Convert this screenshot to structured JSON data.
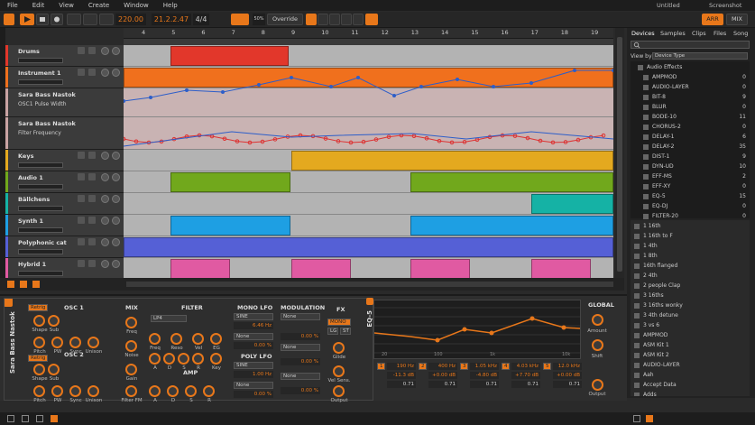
{
  "menu": {
    "items": [
      "File",
      "Edit",
      "View",
      "Create",
      "Window",
      "Help"
    ],
    "doc_title": "Untitled",
    "screenshot_title": "Screenshot"
  },
  "transport": {
    "tempo": "220.00",
    "position": "21.2.2.47",
    "signature": "4/4",
    "override_label": "Override",
    "zoom": "50%"
  },
  "modes": {
    "arr": "ARR",
    "mix": "MIX"
  },
  "ruler": [
    "4",
    "5",
    "6",
    "7",
    "8",
    "9",
    "10",
    "11",
    "12",
    "13",
    "14",
    "15",
    "16",
    "17",
    "18",
    "19"
  ],
  "tracks": [
    {
      "name": "Drums",
      "color": "#e2372b"
    },
    {
      "name": "Instrument 1",
      "color": "#f0701d"
    },
    {
      "name": "Sara Bass Nastok",
      "sub": "OSC1 Pulse Width",
      "color": "#c9a3a3"
    },
    {
      "name": "Sara Bass Nastok",
      "sub": "Filter Frequency",
      "color": "#c9a3a3"
    },
    {
      "name": "Keys",
      "color": "#e4a91f"
    },
    {
      "name": "Audio 1",
      "color": "#71a81c"
    },
    {
      "name": "Bällchens",
      "color": "#15b2a5"
    },
    {
      "name": "Synth 1",
      "color": "#1e9fe3"
    },
    {
      "name": "Polyphonic cat",
      "color": "#5560d6"
    },
    {
      "name": "Hybrid 1",
      "color": "#e05aa2"
    }
  ],
  "browser": {
    "tabs": [
      "Devices",
      "Samples",
      "Clips",
      "Files",
      "Song"
    ],
    "view_by_label": "View by",
    "view_by_value": "Device Type",
    "folder": "Audio Effects",
    "items": [
      {
        "name": "AMPMOD",
        "count": "0"
      },
      {
        "name": "AUDIO-LAYER",
        "count": "0"
      },
      {
        "name": "BIT-8",
        "count": "9"
      },
      {
        "name": "BLUR",
        "count": "0"
      },
      {
        "name": "BODE-10",
        "count": "11"
      },
      {
        "name": "CHORUS-2",
        "count": "0"
      },
      {
        "name": "DELAY-1",
        "count": "6"
      },
      {
        "name": "DELAY-2",
        "count": "35"
      },
      {
        "name": "DIST-1",
        "count": "9"
      },
      {
        "name": "DYN-UD",
        "count": "10"
      },
      {
        "name": "EFF-MS",
        "count": "2"
      },
      {
        "name": "EFF-XY",
        "count": "0"
      },
      {
        "name": "EQ-5",
        "count": "15"
      },
      {
        "name": "EQ-DJ",
        "count": "0"
      },
      {
        "name": "FILTER-20",
        "count": "0"
      }
    ],
    "presets": [
      "1 16th",
      "1 16th to F",
      "1 4th",
      "1 8th",
      "16th flanged",
      "2 4th",
      "2 people Clap",
      "3 16ths",
      "3 16ths wonky",
      "3 4th detune",
      "3 vs 6",
      "AMPMOD",
      "ASM Kit 1",
      "ASM Kit 2",
      "AUDIO-LAYER",
      "Aah",
      "Accept Data",
      "Adds"
    ]
  },
  "device": {
    "name": "Sara Bass Nastok",
    "sections": {
      "osc1": "OSC 1",
      "osc2": "OSC 2",
      "mix": "MIX",
      "filter": "FILTER",
      "amp": "AMP",
      "mono_lfo": "MONO LFO",
      "poly_lfo": "POLY LFO",
      "modulation": "MODULATION",
      "fx": "FX"
    },
    "retrig": "Retrig",
    "filter_type": "LP4",
    "lfo1_shape": "SINE",
    "lfo1_rate": "6.46 Hz",
    "lfo2_shape": "SINE",
    "lfo2_rate": "1.00 Hz",
    "none": "None",
    "percent0": "0.00 %",
    "mono": "MONO",
    "lg": "LG",
    "st": "ST",
    "knob_labels": {
      "pitch": "Pitch",
      "pw": "PW",
      "sync": "Sync",
      "unison": "Unison",
      "shape": "Shape",
      "sub": "Sub",
      "noise": "Noise",
      "gain": "Gain",
      "freq": "Freq",
      "reso": "Reso",
      "vel": "Vel",
      "eg": "EG",
      "a": "A",
      "d": "D",
      "s": "S",
      "r": "R",
      "key": "Key",
      "glide": "Glide",
      "vel_sens": "Vel Sens.",
      "output": "Output",
      "filter_fm": "Filter FM"
    }
  },
  "eq": {
    "name": "EQ-5",
    "global": "GLOBAL",
    "amount": "Amount",
    "shift": "Shift",
    "output": "Output",
    "freq_labels": [
      "20",
      "100",
      "1k",
      "10k"
    ],
    "bands": [
      {
        "n": "1",
        "freq": "190 Hz",
        "gain": "-11.3 dB",
        "q": "0.71"
      },
      {
        "n": "2",
        "freq": "400 Hz",
        "gain": "+0.00 dB",
        "q": "0.71"
      },
      {
        "n": "3",
        "freq": "1.05 kHz",
        "gain": "-4.80 dB",
        "q": "0.71"
      },
      {
        "n": "4",
        "freq": "4.03 kHz",
        "gain": "+7.70 dB",
        "q": "0.71"
      },
      {
        "n": "5",
        "freq": "12.0 kHz",
        "gain": "+0.00 dB",
        "q": "0.71"
      }
    ]
  },
  "colors": {
    "accent": "#e8771a"
  }
}
